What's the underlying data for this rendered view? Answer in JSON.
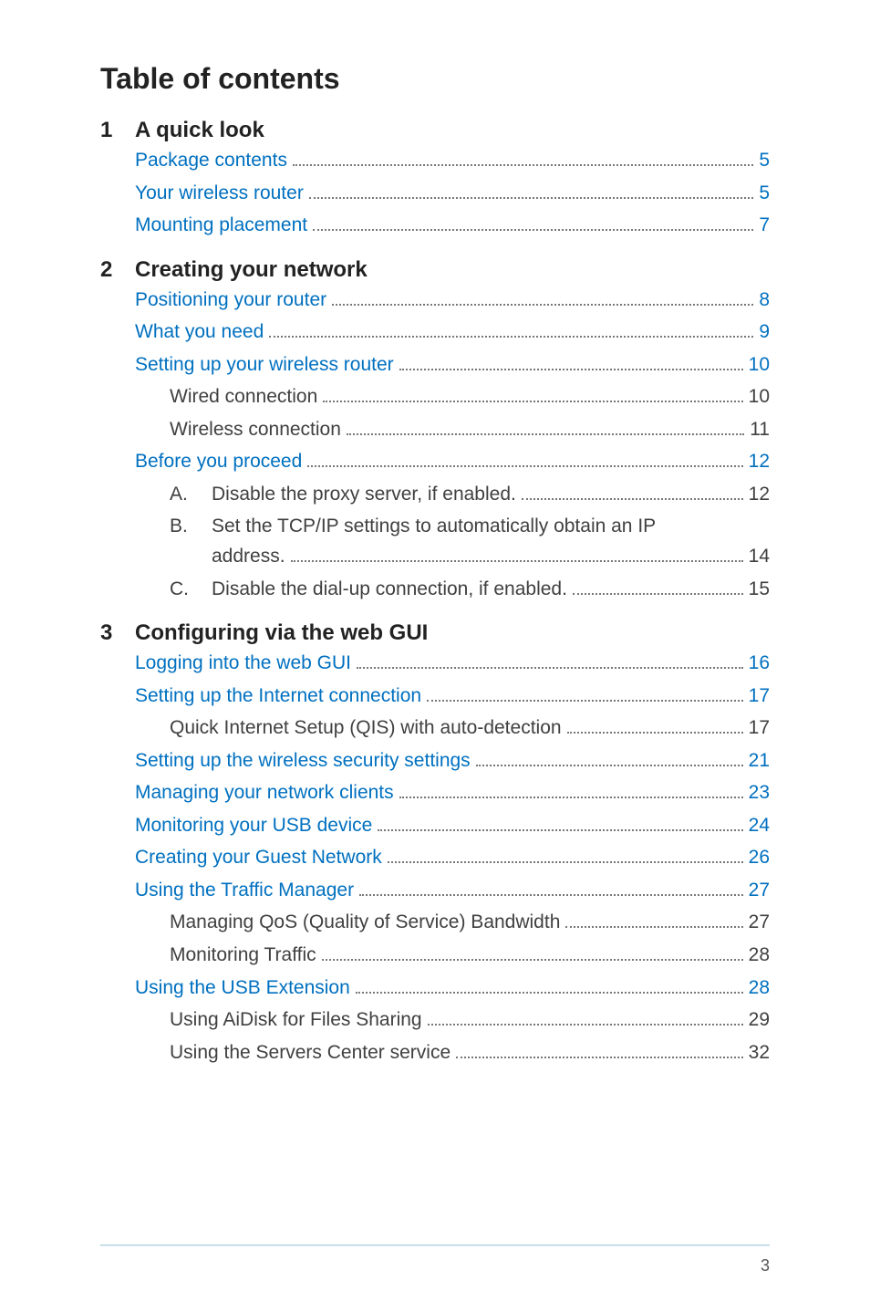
{
  "title": "Table of contents",
  "footer_page": "3",
  "chapters": [
    {
      "num": "1",
      "title": "A quick look",
      "entries": [
        {
          "level": 1,
          "label": "Package contents",
          "page": "5",
          "link": true
        },
        {
          "level": 1,
          "label": "Your wireless router",
          "page": "5",
          "link": true
        },
        {
          "level": 1,
          "label": "Mounting placement",
          "page": "7",
          "link": true
        }
      ]
    },
    {
      "num": "2",
      "title": "Creating your network",
      "entries": [
        {
          "level": 1,
          "label": "Positioning your router",
          "page": "8",
          "link": true
        },
        {
          "level": 1,
          "label": "What you need",
          "page": "9",
          "link": true
        },
        {
          "level": 1,
          "label": "Setting up your wireless router",
          "page": "10",
          "link": true
        },
        {
          "level": 2,
          "label": "Wired connection",
          "page": "10",
          "link": false
        },
        {
          "level": 2,
          "label": "Wireless connection",
          "page": "11",
          "link": false
        },
        {
          "level": 1,
          "label": "Before you proceed",
          "page": "12",
          "link": true
        },
        {
          "level": 2,
          "letter": "A.",
          "label": "Disable the proxy server, if enabled.",
          "page": "12",
          "link": false
        },
        {
          "level": 2,
          "letter": "B.",
          "label": "Set the TCP/IP settings to automatically obtain an IP",
          "label2": "address.",
          "page": "14",
          "link": false,
          "multi": true
        },
        {
          "level": 2,
          "letter": "C.",
          "label": "Disable the dial-up connection, if enabled.",
          "page": "15",
          "link": false
        }
      ]
    },
    {
      "num": "3",
      "title": "Configuring via the web GUI",
      "entries": [
        {
          "level": 1,
          "label": "Logging into the web GUI",
          "page": "16",
          "link": true
        },
        {
          "level": 1,
          "label": "Setting up the Internet connection",
          "page": "17",
          "link": true
        },
        {
          "level": 2,
          "label": "Quick Internet Setup (QIS) with auto-detection",
          "page": "17",
          "link": false
        },
        {
          "level": 1,
          "label": "Setting up the wireless security settings",
          "page": "21",
          "link": true
        },
        {
          "level": 1,
          "label": "Managing your network clients",
          "page": "23",
          "link": true
        },
        {
          "level": 1,
          "label": "Monitoring your USB device",
          "page": "24",
          "link": true
        },
        {
          "level": 1,
          "label": "Creating your Guest Network",
          "page": "26",
          "link": true
        },
        {
          "level": 1,
          "label": "Using the Traffic Manager",
          "page": "27",
          "link": true
        },
        {
          "level": 2,
          "label": "Managing QoS (Quality of Service) Bandwidth",
          "page": "27",
          "link": false
        },
        {
          "level": 2,
          "label": "Monitoring Traffic",
          "page": "28",
          "link": false
        },
        {
          "level": 1,
          "label": "Using the USB Extension",
          "page": "28",
          "link": true
        },
        {
          "level": 2,
          "label": "Using AiDisk for Files Sharing",
          "page": "29",
          "link": false
        },
        {
          "level": 2,
          "label": "Using the Servers Center service",
          "page": "32",
          "link": false
        }
      ]
    }
  ]
}
